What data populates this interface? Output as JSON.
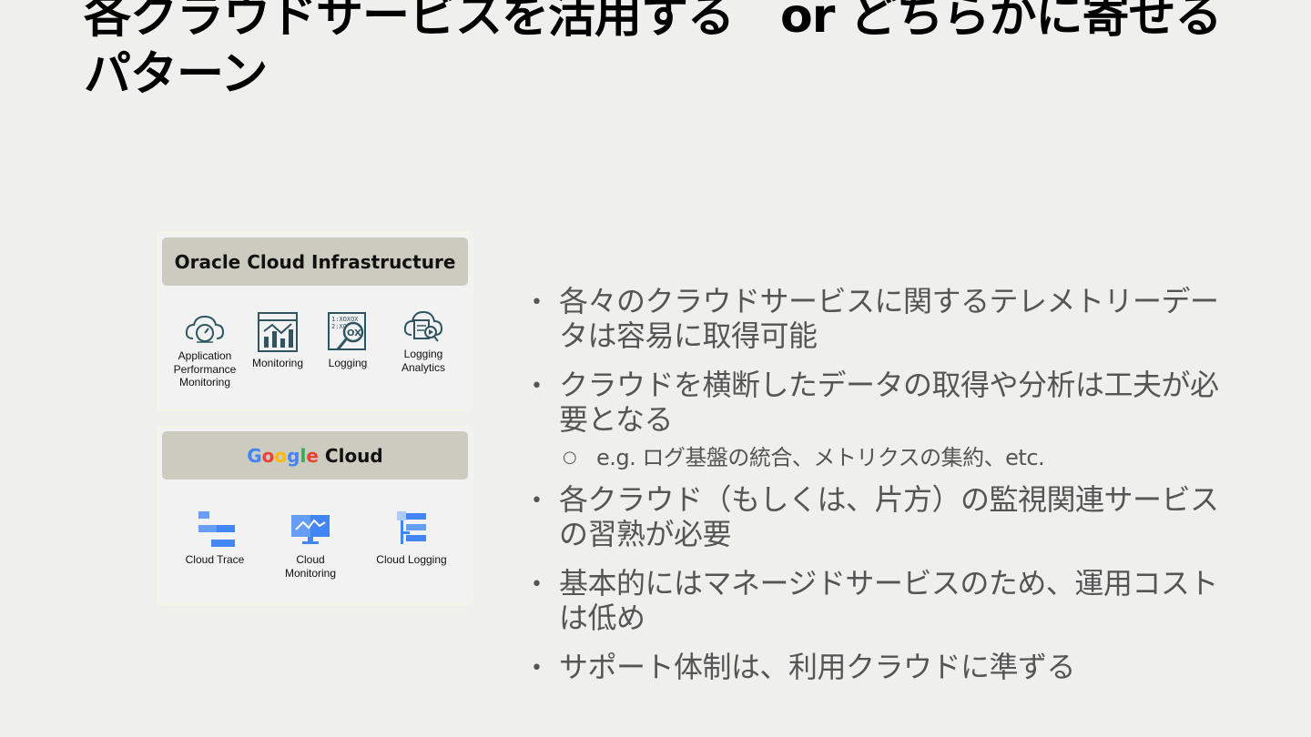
{
  "title": {
    "line1": "各クラウドサービスを活用する　or どちらかに寄せる",
    "line2": "パターン"
  },
  "oci": {
    "header": "Oracle Cloud Infrastructure",
    "services": [
      {
        "label": "Application Performance Monitoring",
        "icon": "apm-cloud-gauge-icon"
      },
      {
        "label": "Monitoring",
        "icon": "monitoring-chart-icon"
      },
      {
        "label": "Logging",
        "icon": "logging-magnifier-icon"
      },
      {
        "label": "Logging Analytics",
        "icon": "logging-analytics-icon"
      }
    ]
  },
  "gcp": {
    "header_brand_letters": [
      "G",
      "o",
      "o",
      "g",
      "l",
      "e"
    ],
    "header_brand_colors": [
      "#4285F4",
      "#EA4335",
      "#FBBC05",
      "#4285F4",
      "#34A853",
      "#EA4335"
    ],
    "header_suffix": "Cloud",
    "services": [
      {
        "label": "Cloud Trace",
        "icon": "cloud-trace-icon"
      },
      {
        "label": "Cloud Monitoring",
        "icon": "cloud-monitoring-icon"
      },
      {
        "label": "Cloud Logging",
        "icon": "cloud-logging-icon"
      }
    ]
  },
  "bullets": {
    "b1": "各々のクラウドサービスに関するテレメトリーデータは容易に取得可能",
    "b2": "クラウドを横断したデータの取得や分析は工夫が必要となる",
    "b2_sub": "e.g. ログ基盤の統合、メトリクスの集約、etc.",
    "b3": "各クラウド（もしくは、片方）の監視関連サービスの習熟が必要",
    "b4": "基本的にはマネージドサービスのため、運用コストは低め",
    "b5": "サポート体制は、利用クラウドに準ずる"
  }
}
